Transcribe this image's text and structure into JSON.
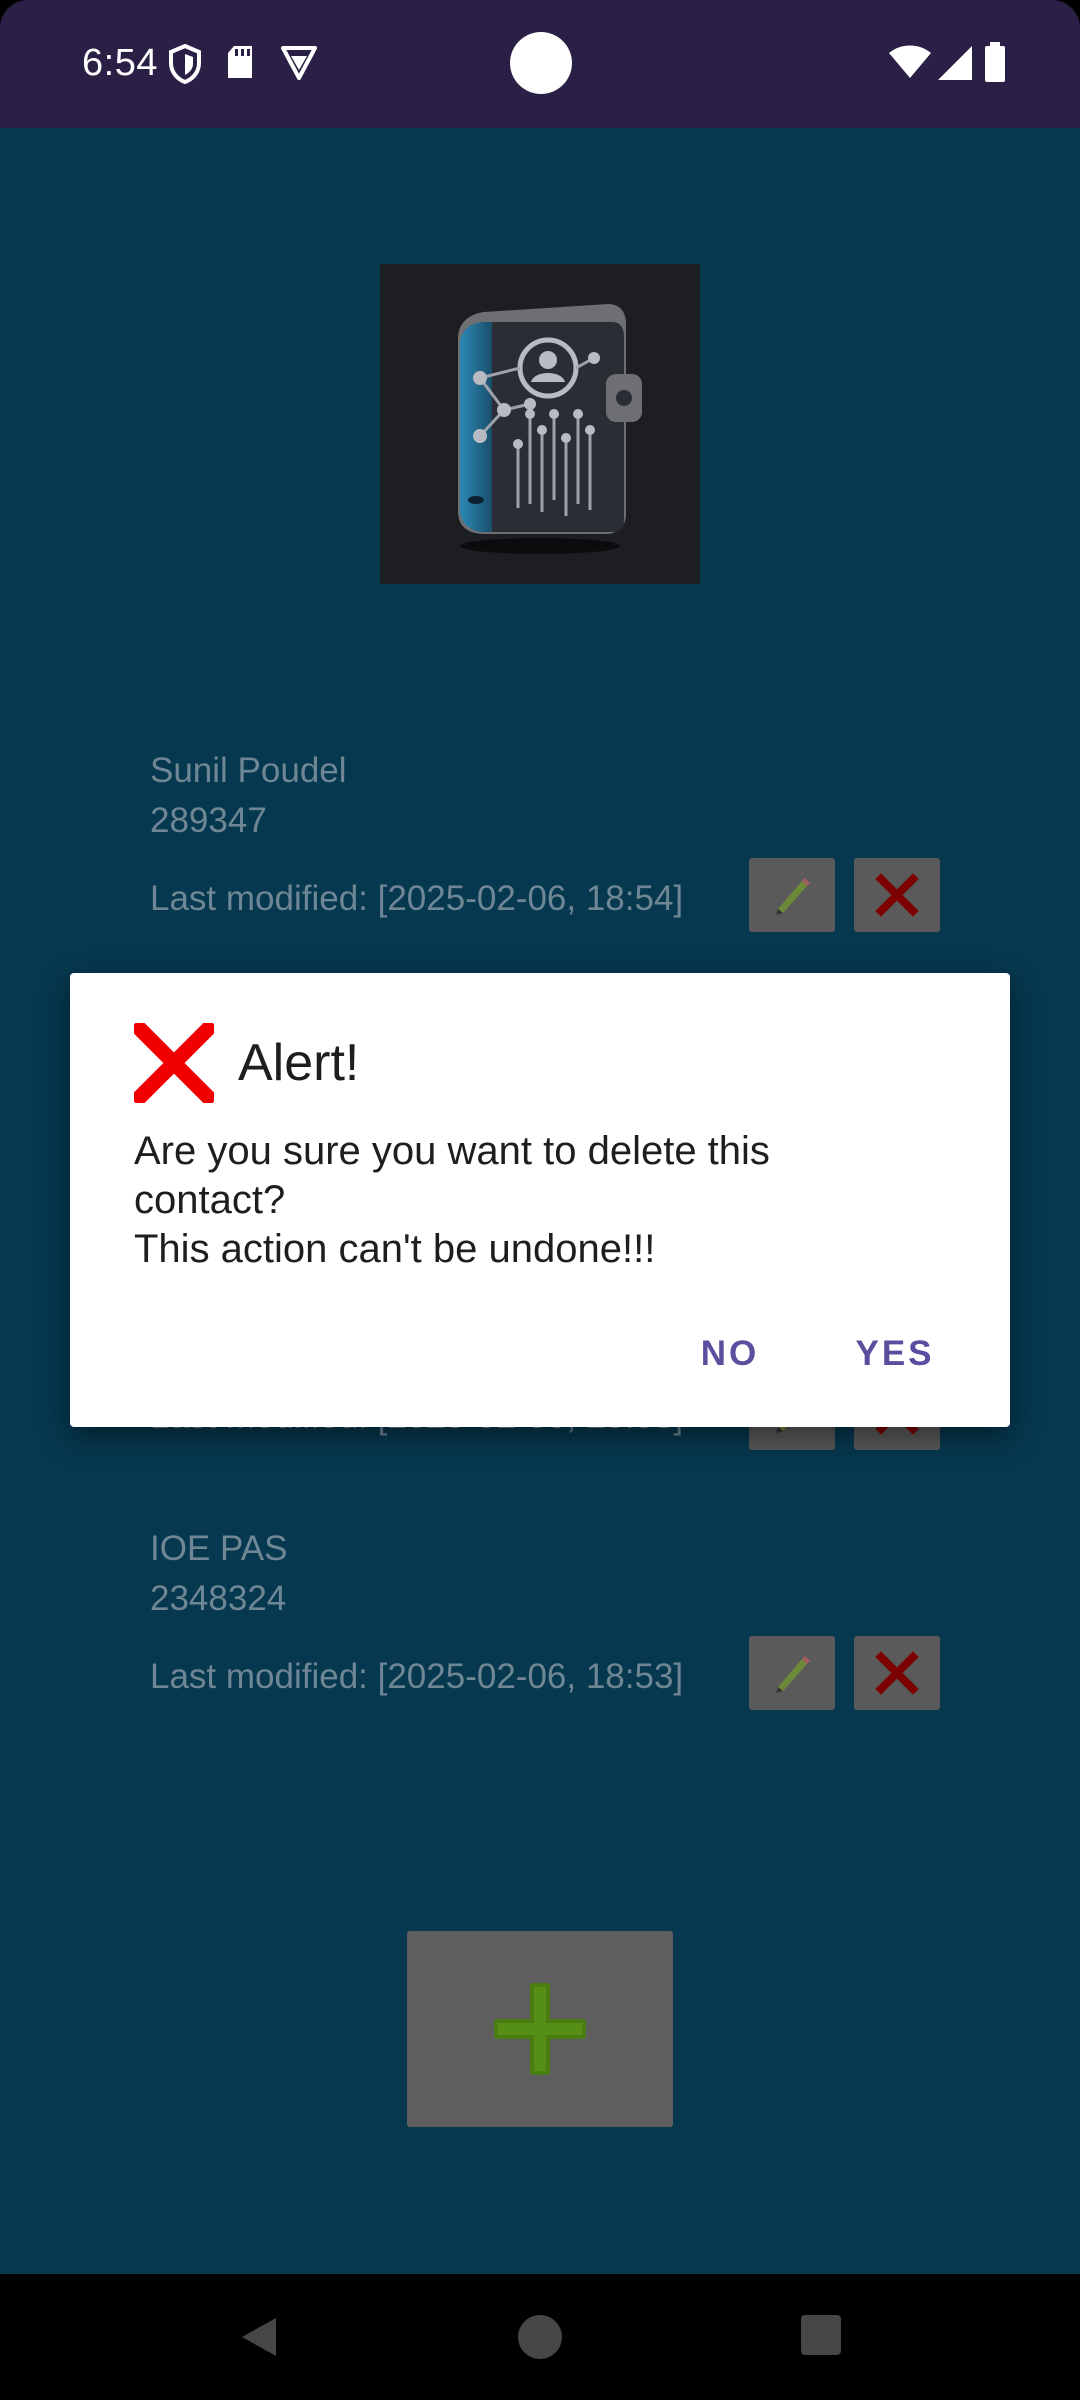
{
  "status_bar": {
    "time": "6:54",
    "left_icons": [
      "shield-icon",
      "sd-card-icon",
      "vpn-badge-icon"
    ],
    "right_icons": [
      "wifi-icon",
      "cell-signal-icon",
      "battery-icon"
    ]
  },
  "app": {
    "background_color": "#06384f",
    "logo": "contact-book-logo"
  },
  "contacts": [
    {
      "name": "Sunil Poudel",
      "phone": "289347",
      "modified": "Last modified: [2025-02-06, 18:54]"
    },
    {
      "name": "",
      "phone": "",
      "modified": "Last modified: [2025-02-06, 18:53]"
    },
    {
      "name": "IOE PAS",
      "phone": "2348324",
      "modified": "Last modified: [2025-02-06, 18:53]"
    }
  ],
  "dialog": {
    "title": "Alert!",
    "message_lines": [
      "Are you sure you want to delete this",
      "contact?",
      "This action can't be undone!!!"
    ],
    "negative_label": "NO",
    "positive_label": "YES",
    "accent_color": "#5c4d9e"
  },
  "nav_bar": {
    "items": [
      "back-icon",
      "home-icon",
      "recents-icon"
    ]
  }
}
